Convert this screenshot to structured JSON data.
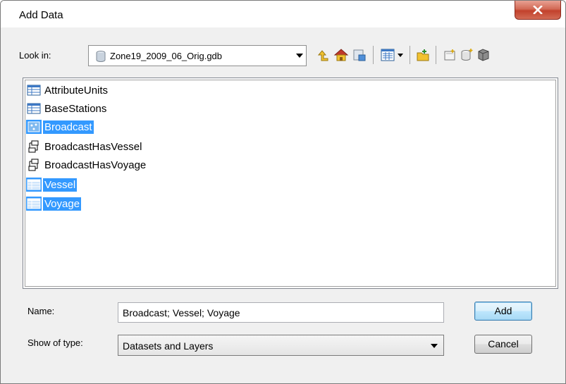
{
  "window": {
    "title": "Add Data",
    "close_label": "X"
  },
  "toolbar": {
    "look_in_label": "Look in:",
    "look_in_value": "Zone19_2009_06_Orig.gdb",
    "icons": [
      "up-one-level-icon",
      "home-icon",
      "connect-to-folder-icon",
      "view-list-icon",
      "view-menu-arrow-icon",
      "new-connection-icon",
      "new-folder-icon",
      "new-database-icon",
      "catalog-icon"
    ]
  },
  "file_list": {
    "items": [
      {
        "label": "AttributeUnits",
        "icon": "table-icon",
        "selected": false
      },
      {
        "label": "BaseStations",
        "icon": "table-icon",
        "selected": false
      },
      {
        "label": "Broadcast",
        "icon": "point-feature-class-icon",
        "selected": true
      },
      {
        "label": "BroadcastHasVessel",
        "icon": "relationship-class-icon",
        "selected": false
      },
      {
        "label": "BroadcastHasVoyage",
        "icon": "relationship-class-icon",
        "selected": false
      },
      {
        "label": "Vessel",
        "icon": "table-icon",
        "selected": true
      },
      {
        "label": "Voyage",
        "icon": "table-icon",
        "selected": true
      }
    ]
  },
  "form": {
    "name_label": "Name:",
    "name_value": "Broadcast; Vessel; Voyage",
    "type_label": "Show of type:",
    "type_value": "Datasets and Layers"
  },
  "buttons": {
    "add": "Add",
    "cancel": "Cancel"
  },
  "colors": {
    "selection": "#3399ff",
    "close_button": "#c2412c"
  }
}
